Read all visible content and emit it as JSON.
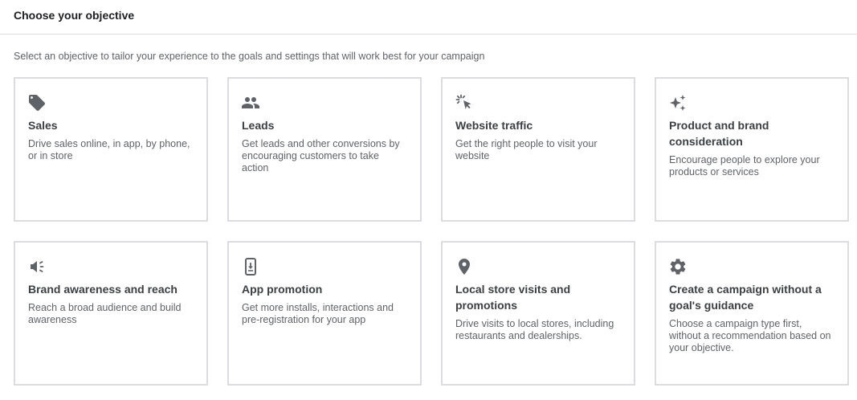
{
  "header": {
    "title": "Choose your objective"
  },
  "subtitle": "Select an objective to tailor your experience to the goals and settings that will work best for your campaign",
  "colors": {
    "icon": "#5f6368",
    "card_border": "#dadce0",
    "title": "#3c4043",
    "description": "#5f6368"
  },
  "cards": [
    {
      "icon": "tag-icon",
      "title": "Sales",
      "description": "Drive sales online, in app, by phone, or in store"
    },
    {
      "icon": "people-icon",
      "title": "Leads",
      "description": "Get leads and other conversions by encouraging customers to take action"
    },
    {
      "icon": "cursor-click-icon",
      "title": "Website traffic",
      "description": "Get the right people to visit your website"
    },
    {
      "icon": "sparkle-icon",
      "title": "Product and brand consideration",
      "description": "Encourage people to explore your products or services"
    },
    {
      "icon": "megaphone-icon",
      "title": "Brand awareness and reach",
      "description": "Reach a broad audience and build awareness"
    },
    {
      "icon": "phone-download-icon",
      "title": "App promotion",
      "description": "Get more installs, interactions and pre-registration for your app"
    },
    {
      "icon": "location-pin-icon",
      "title": "Local store visits and promotions",
      "description": "Drive visits to local stores, including restaurants and dealerships."
    },
    {
      "icon": "gear-icon",
      "title": "Create a campaign without a goal's guidance",
      "description": "Choose a campaign type first, without a recommendation based on your objective."
    }
  ]
}
